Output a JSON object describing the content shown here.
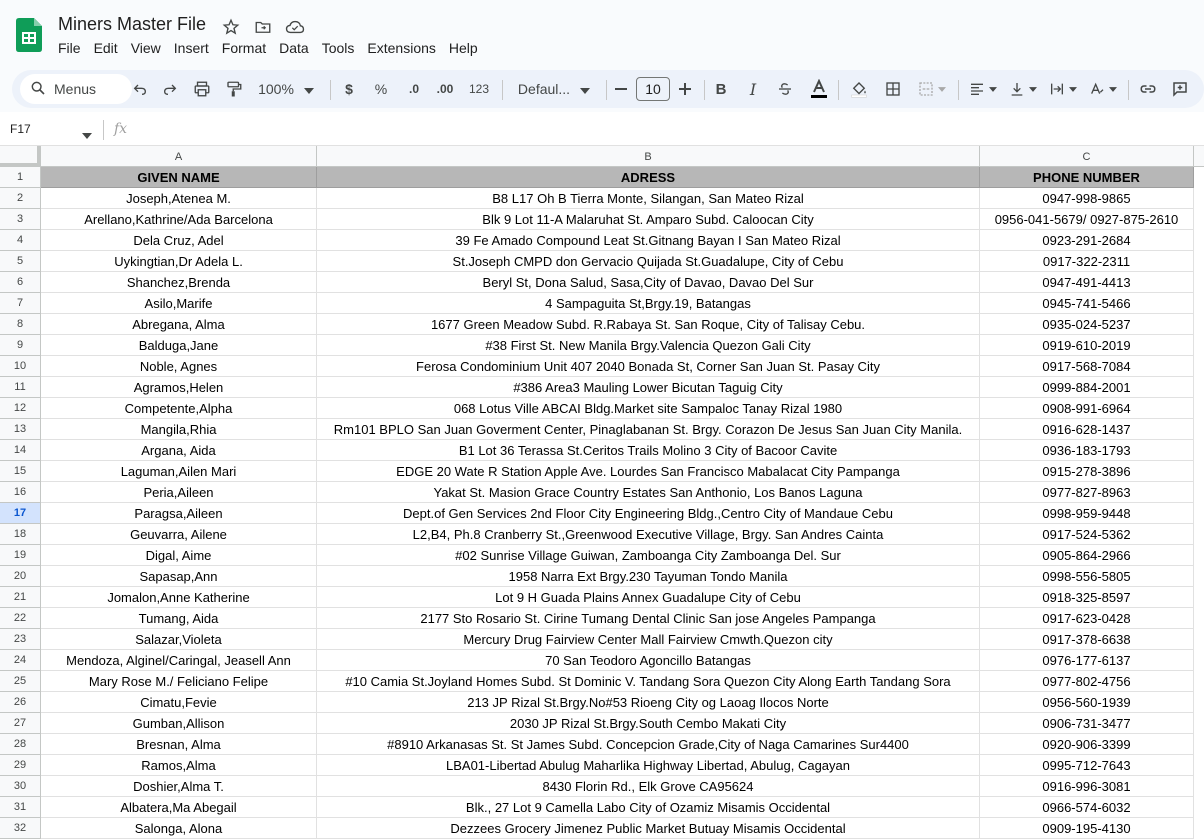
{
  "app": {
    "title": "Miners Master File",
    "menu": [
      "File",
      "Edit",
      "View",
      "Insert",
      "Format",
      "Data",
      "Tools",
      "Extensions",
      "Help"
    ]
  },
  "toolbar": {
    "search_label": "Menus",
    "zoom": "100%",
    "currency": "$",
    "percent": "%",
    "decrease_decimal": ".0",
    "increase_decimal": ".00",
    "number_format": "123",
    "font": "Defaul...",
    "font_size": "10",
    "bold": "B",
    "italic": "I"
  },
  "formula_bar": {
    "name_box": "F17",
    "fx": "fx",
    "value": ""
  },
  "grid": {
    "column_headers": [
      "A",
      "B",
      "C"
    ],
    "active_row": 17,
    "header_row": [
      "GIVEN NAME",
      "ADRESS",
      "PHONE NUMBER"
    ],
    "rows": [
      [
        "Joseph,Atenea M.",
        "B8 L17 Oh B Tierra Monte, Silangan, San Mateo Rizal",
        "0947-998-9865"
      ],
      [
        "Arellano,Kathrine/Ada Barcelona",
        "Blk 9 Lot 11-A Malaruhat St. Amparo Subd. Caloocan City",
        "0956-041-5679/ 0927-875-2610"
      ],
      [
        "Dela Cruz, Adel",
        "39 Fe Amado Compound Leat St.Gitnang Bayan I San Mateo Rizal",
        "0923-291-2684"
      ],
      [
        "Uykingtian,Dr Adela L.",
        "St.Joseph CMPD don Gervacio Quijada St.Guadalupe, City of Cebu",
        "0917-322-2311"
      ],
      [
        "Shanchez,Brenda",
        "Beryl St, Dona Salud, Sasa,City of Davao, Davao Del Sur",
        "0947-491-4413"
      ],
      [
        "Asilo,Marife",
        "4 Sampaguita St,Brgy.19, Batangas",
        "0945-741-5466"
      ],
      [
        "Abregana, Alma",
        "1677 Green Meadow Subd. R.Rabaya St. San Roque, City of Talisay Cebu.",
        "0935-024-5237"
      ],
      [
        "Balduga,Jane",
        "#38 First St. New Manila Brgy.Valencia Quezon Gali City",
        "0919-610-2019"
      ],
      [
        "Noble, Agnes",
        "Ferosa Condominium Unit  407 2040 Bonada St, Corner San Juan St. Pasay City",
        "0917-568-7084"
      ],
      [
        "Agramos,Helen",
        "#386 Area3 Mauling Lower Bicutan Taguig City",
        "0999-884-2001"
      ],
      [
        "Competente,Alpha",
        "068 Lotus Ville ABCAI Bldg.Market site Sampaloc Tanay Rizal 1980",
        "0908-991-6964"
      ],
      [
        "Mangila,Rhia",
        "Rm101 BPLO San Juan Goverment Center, Pinaglabanan St. Brgy. Corazon De Jesus San Juan City Manila.",
        "0916-628-1437"
      ],
      [
        "Argana, Aida",
        "B1 Lot 36 Terassa St.Ceritos Trails Molino 3 City of Bacoor Cavite",
        "0936-183-1793"
      ],
      [
        "Laguman,Ailen Mari",
        "EDGE 20 Wate R Station Apple Ave. Lourdes San Francisco Mabalacat  City Pampanga",
        "0915-278-3896"
      ],
      [
        "Peria,Aileen",
        "Yakat St. Masion Grace Country Estates San Anthonio, Los Banos Laguna",
        "0977-827-8963"
      ],
      [
        "Paragsa,Aileen",
        "Dept.of Gen Services 2nd Floor City Engineering Bldg.,Centro City of Mandaue Cebu",
        "0998-959-9448"
      ],
      [
        "Geuvarra, Ailene",
        "L2,B4, Ph.8 Cranberry St.,Greenwood Executive Village, Brgy. San Andres Cainta",
        "0917-524-5362"
      ],
      [
        "Digal, Aime",
        "#02 Sunrise Village Guiwan, Zamboanga City Zamboanga Del. Sur",
        "0905-864-2966"
      ],
      [
        "Sapasap,Ann",
        "1958 Narra Ext Brgy.230 Tayuman Tondo Manila",
        "0998-556-5805"
      ],
      [
        "Jomalon,Anne Katherine",
        "Lot 9 H Guada Plains Annex Guadalupe City of Cebu",
        "0918-325-8597"
      ],
      [
        "Tumang, Aida",
        "2177 Sto Rosario St. Cirine Tumang Dental Clinic San jose Angeles Pampanga",
        "0917-623-0428"
      ],
      [
        "Salazar,Violeta",
        "Mercury Drug Fairview Center Mall Fairview Cmwth.Quezon city",
        "0917-378-6638"
      ],
      [
        "Mendoza, Alginel/Caringal, Jeasell Ann",
        "70 San Teodoro Agoncillo Batangas",
        "0976-177-6137"
      ],
      [
        "Mary Rose M./ Feliciano Felipe",
        "#10 Camia St.Joyland Homes Subd. St Dominic V. Tandang Sora Quezon City Along Earth Tandang Sora",
        "0977-802-4756"
      ],
      [
        "Cimatu,Fevie",
        "213 JP Rizal St.Brgy.No#53 Rioeng City og Laoag Ilocos Norte",
        "0956-560-1939"
      ],
      [
        "Gumban,Allison",
        "2030 JP Rizal St.Brgy.South Cembo Makati City",
        "0906-731-3477"
      ],
      [
        "Bresnan, Alma",
        "#8910 Arkanasas St. St James Subd. Concepcion Grade,City of Naga Camarines Sur4400",
        "0920-906-3399"
      ],
      [
        "Ramos,Alma",
        "LBA01-Libertad Abulug Maharlika Highway Libertad, Abulug, Cagayan",
        "0995-712-7643"
      ],
      [
        "Doshier,Alma T.",
        "8430 Florin Rd., Elk Grove CA95624",
        "0916-996-3081"
      ],
      [
        "Albatera,Ma Abegail",
        "Blk., 27 Lot 9 Camella Labo City of Ozamiz Misamis Occidental",
        "0966-574-6032"
      ],
      [
        "Salonga, Alona",
        "Dezzees Grocery Jimenez Public Market Butuay Misamis Occidental",
        "0909-195-4130"
      ]
    ]
  }
}
